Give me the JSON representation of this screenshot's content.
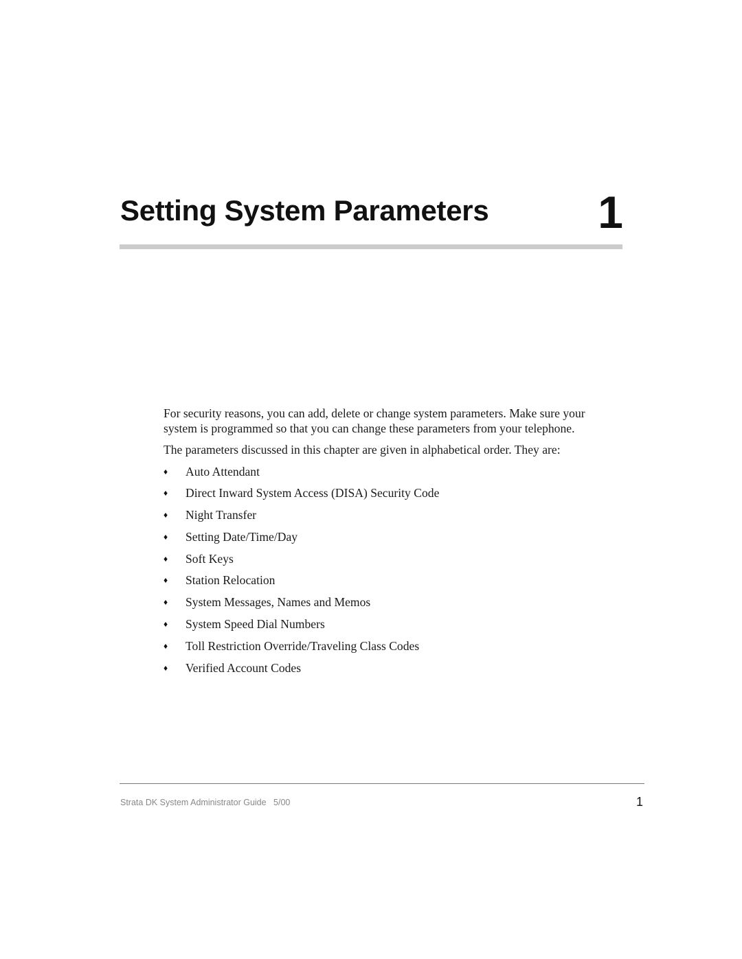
{
  "chapter": {
    "title": "Setting System Parameters",
    "number": "1"
  },
  "body": {
    "paragraphs": [
      "For security reasons, you can add, delete or change system parameters. Make sure your system is programmed so that you can change these parameters from your telephone.",
      "The parameters discussed in this chapter are given in alphabetical order. They are:"
    ],
    "bullet_icon": "diamond-bullet",
    "bullet_glyph": "♦",
    "items": [
      "Auto Attendant",
      "Direct Inward System Access (DISA) Security Code",
      "Night Transfer",
      "Setting Date/Time/Day",
      "Soft Keys",
      "Station Relocation",
      "System Messages, Names and Memos",
      "System Speed Dial Numbers",
      "Toll Restriction Override/Traveling Class Codes",
      "Verified Account Codes"
    ]
  },
  "footer": {
    "guide_title": "Strata DK System Administrator Guide",
    "date": "5/00",
    "page_number": "1"
  },
  "colors": {
    "title_rule": "#cccccc",
    "footer_rule": "#777777",
    "footer_text": "#888888"
  }
}
